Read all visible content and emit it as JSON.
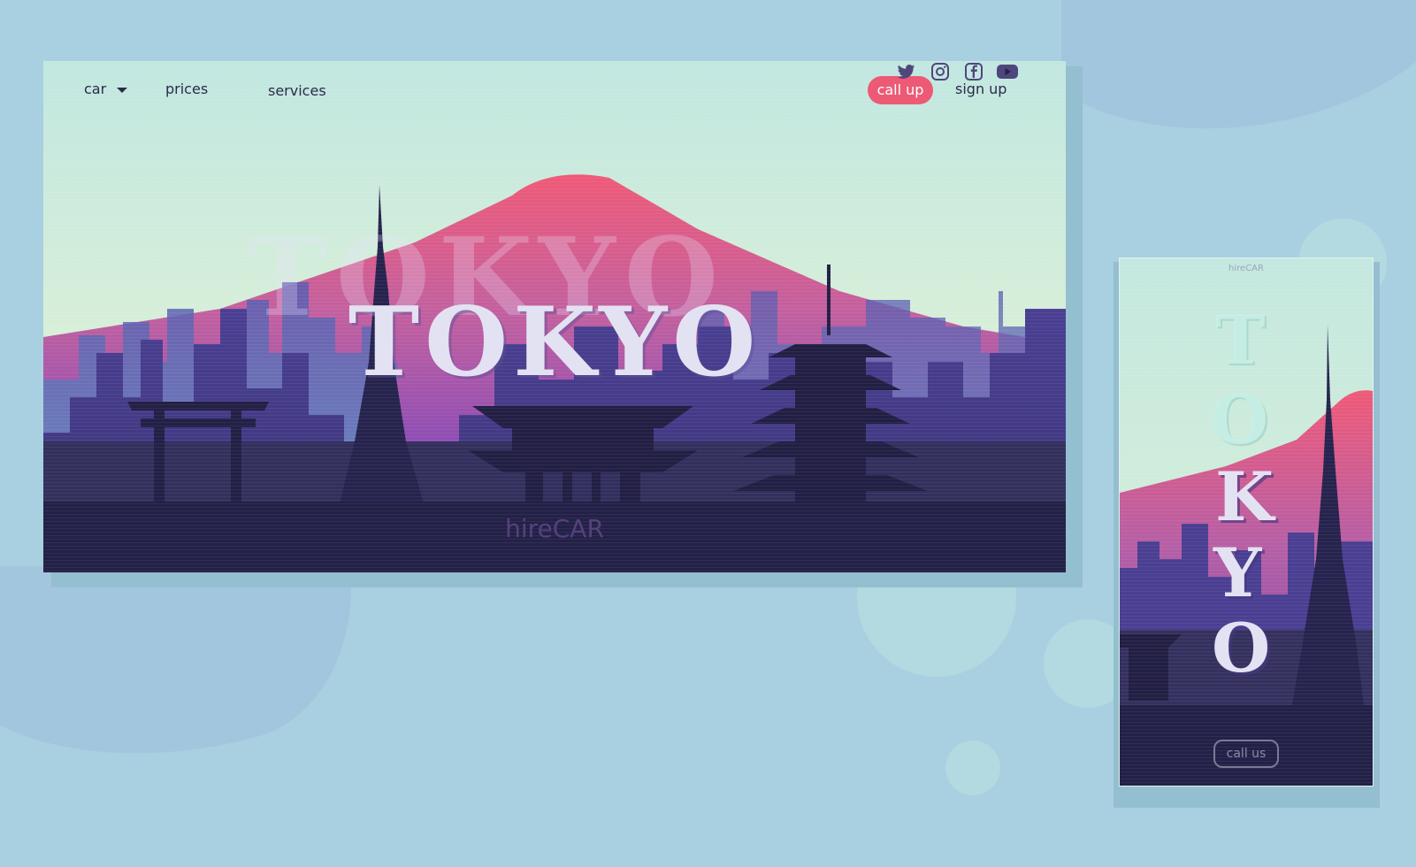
{
  "desktop": {
    "nav": {
      "car_label": "car",
      "prices_label": "prices",
      "services_label": "services",
      "call_up_label": "call up",
      "sign_up_label": "sign up"
    },
    "title": "TOKYO",
    "ghost_title": "TOKYO",
    "brand": "hireCAR",
    "social_icons": [
      "twitter-icon",
      "instagram-icon",
      "facebook-icon",
      "youtube-icon"
    ]
  },
  "mobile": {
    "brand": "hireCAR",
    "title_letters": [
      "T",
      "O",
      "K",
      "Y",
      "O"
    ],
    "call_us_label": "call us"
  },
  "colors": {
    "background": "#a9d0e0",
    "sky_top": "#c4e8df",
    "mountain_peak": "#ee5a7a",
    "mountain_base": "#7a48b8",
    "skyline": "#2c2a58",
    "footer": "#222047",
    "accent": "#ec5a76",
    "brand_text": "#55417c"
  }
}
